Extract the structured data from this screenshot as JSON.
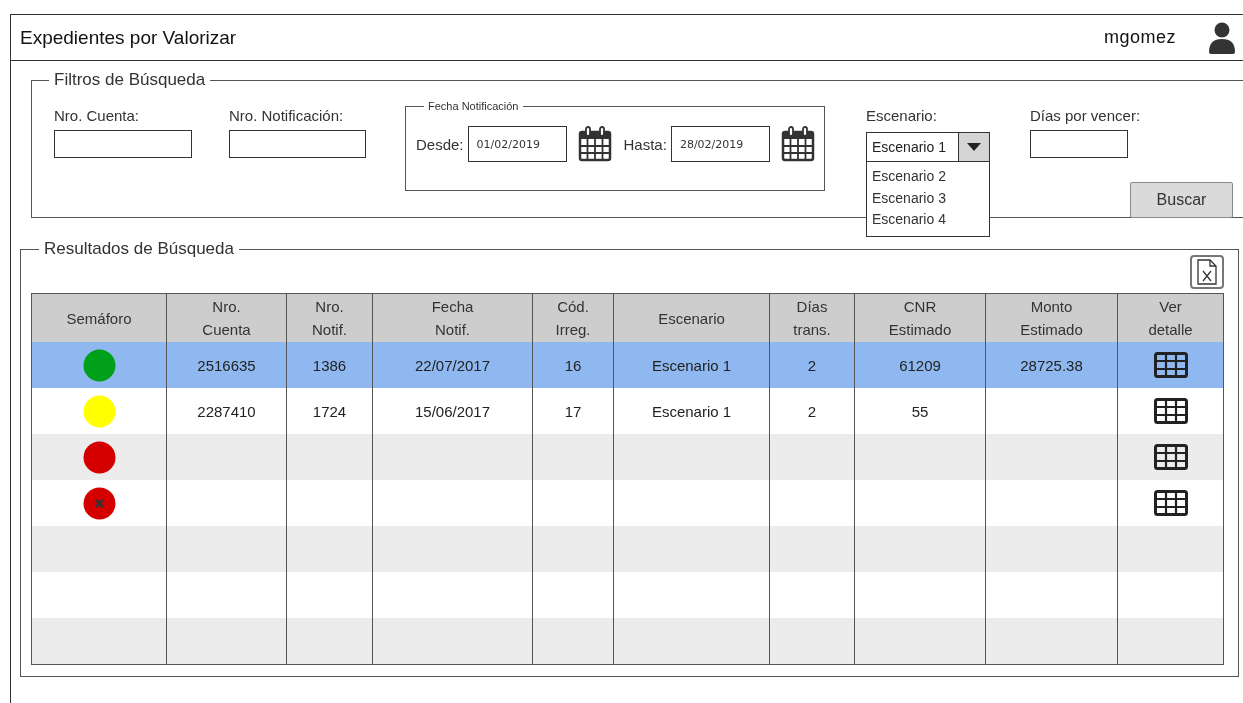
{
  "window": {
    "title": "Expedientes por Valorizar",
    "user": "mgomez"
  },
  "filters": {
    "legend": "Filtros de Búsqueda",
    "account": {
      "label": "Nro. Cuenta:"
    },
    "notification": {
      "label": "Nro. Notificación:"
    },
    "date_group": {
      "legend": "Fecha Notificación",
      "from": {
        "label": "Desde:",
        "value": "01/02/2019"
      },
      "to": {
        "label": "Hasta:",
        "value": "28/02/2019"
      }
    },
    "scenario": {
      "label": "Escenario:",
      "value": "Escenario 1",
      "expanded": true,
      "options": [
        "Escenario 2",
        "Escenario 3",
        "Escenario 4"
      ]
    },
    "days": {
      "label": "Días por vencer:"
    },
    "search_button": "Buscar"
  },
  "results": {
    "legend": "Resultados de Búsqueda",
    "columns": [
      "Semáforo",
      "Nro.\nCuenta",
      "Nro.\nNotif.",
      "Fecha\nNotif.",
      "Cód.\nIrreg.",
      "Escenario",
      "Días\ntrans.",
      "CNR\nEstimado",
      "Monto\nEstimado",
      "Ver\ndetalle"
    ],
    "rows": [
      {
        "selected": true,
        "status": {
          "kind": "dot",
          "color": "#00a01a"
        },
        "cells": [
          "2516635",
          "1386",
          "22/07/2017",
          "16",
          "Escenario 1",
          "2",
          "61209",
          "28725.38"
        ],
        "detail": true
      },
      {
        "selected": false,
        "status": {
          "kind": "dot",
          "color": "#ffff00"
        },
        "cells": [
          "2287410",
          "1724",
          "15/06/2017",
          "17",
          "Escenario 1",
          "2",
          "55"
        ],
        "detail": true
      },
      {
        "selected": false,
        "status": {
          "kind": "dot",
          "color": "#d40000"
        },
        "detail": true
      },
      {
        "selected": false,
        "status": {
          "kind": "cancelled",
          "color": "#d40000"
        },
        "detail": true
      },
      {
        "selected": false,
        "detail": false
      },
      {
        "selected": false,
        "detail": false
      },
      {
        "selected": false,
        "detail": false
      }
    ]
  }
}
